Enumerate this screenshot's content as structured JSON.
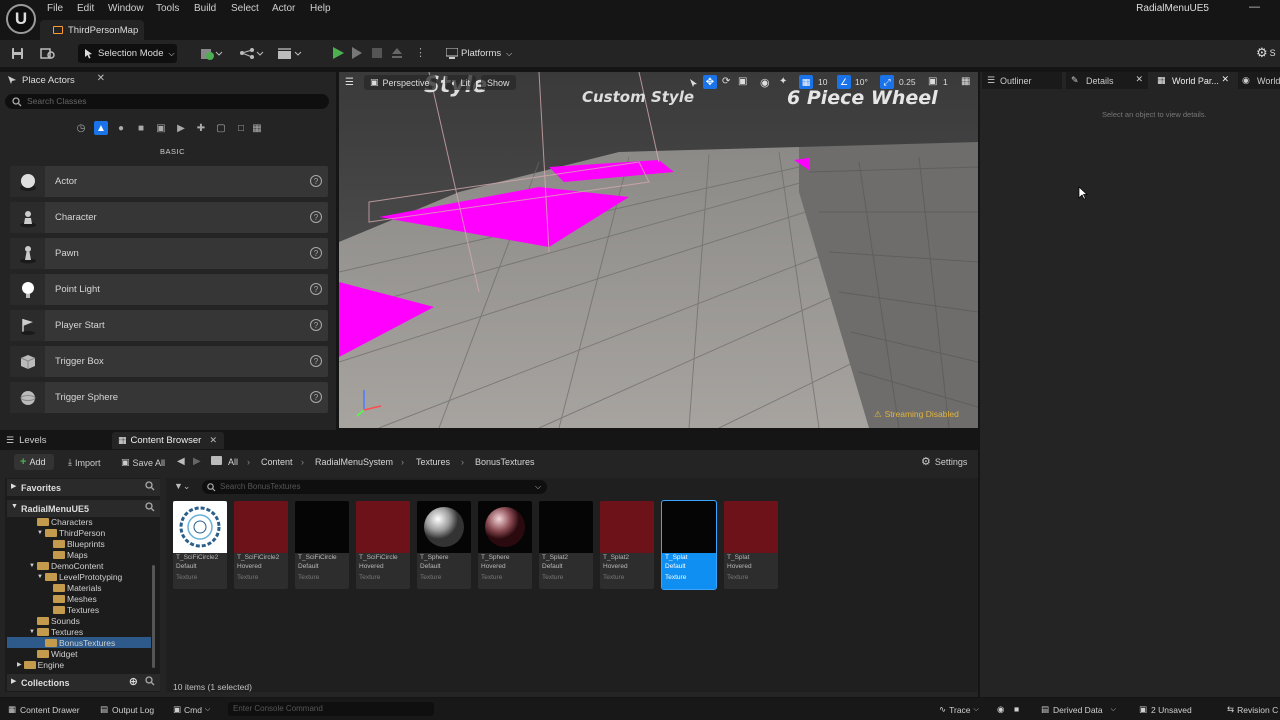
{
  "menubar": {
    "logo": "U",
    "items": [
      "File",
      "Edit",
      "Window",
      "Tools",
      "Build",
      "Select",
      "Actor",
      "Help"
    ],
    "project_name": "RadialMenuUE5",
    "minimize": "—"
  },
  "document_tab": {
    "label": "ThirdPersonMap"
  },
  "toolbar": {
    "selection_mode": "Selection Mode",
    "platforms": "Platforms",
    "settings_partial": "S"
  },
  "place_actors": {
    "tab_label": "Place Actors",
    "search_placeholder": "Search Classes",
    "category_label": "BASIC",
    "items": [
      {
        "label": "Actor",
        "icon": "sphere-icon"
      },
      {
        "label": "Character",
        "icon": "character-icon"
      },
      {
        "label": "Pawn",
        "icon": "pawn-icon"
      },
      {
        "label": "Point Light",
        "icon": "light-bulb-icon"
      },
      {
        "label": "Player Start",
        "icon": "flag-icon"
      },
      {
        "label": "Trigger Box",
        "icon": "cube-icon"
      },
      {
        "label": "Trigger Sphere",
        "icon": "sphere-icon"
      }
    ]
  },
  "viewport": {
    "perspective": "Perspective",
    "lit": "Lit",
    "show": "Show",
    "grid_snap": "10",
    "rotation_snap": "10°",
    "scale_snap": "0.25",
    "camera_speed": "1",
    "scene_text_1": "Style",
    "scene_text_2": "Custom Style",
    "scene_text_3": "6 Piece Wheel",
    "streaming_status": "Streaming Disabled",
    "accent_color": "#ff00ff"
  },
  "right_panel": {
    "tabs": [
      "Outliner",
      "Details",
      "World Par...",
      "World"
    ],
    "empty_message": "Select an object to view details."
  },
  "bottom_tabs": {
    "levels": "Levels",
    "content_browser": "Content Browser"
  },
  "content_browser": {
    "add": "Add",
    "import": "Import",
    "save_all": "Save All",
    "settings": "Settings",
    "breadcrumb": [
      "All",
      "Content",
      "RadialMenuSystem",
      "Textures",
      "BonusTextures"
    ],
    "filter_placeholder": "Search BonusTextures",
    "favorites": "Favorites",
    "project_root": "RadialMenuUE5",
    "tree": [
      {
        "label": "Characters",
        "depth": 2
      },
      {
        "label": "ThirdPerson",
        "depth": 2
      },
      {
        "label": "Blueprints",
        "depth": 3
      },
      {
        "label": "Maps",
        "depth": 3
      },
      {
        "label": "DemoContent",
        "depth": 1
      },
      {
        "label": "LevelPrototyping",
        "depth": 2
      },
      {
        "label": "Materials",
        "depth": 3
      },
      {
        "label": "Meshes",
        "depth": 3
      },
      {
        "label": "Textures",
        "depth": 3
      },
      {
        "label": "Sounds",
        "depth": 1
      },
      {
        "label": "Textures",
        "depth": 1
      },
      {
        "label": "BonusTextures",
        "depth": 2
      },
      {
        "label": "Widget",
        "depth": 1
      },
      {
        "label": "Engine",
        "depth": 0
      }
    ],
    "collections": "Collections",
    "assets": [
      {
        "name1": "T_SciFiCircle2",
        "name2": "Default",
        "type": "Texture",
        "thumb": "circle"
      },
      {
        "name1": "T_SciFiCircle2",
        "name2": "Hovered",
        "type": "Texture",
        "thumb": "red"
      },
      {
        "name1": "T_SciFiCircle",
        "name2": "Default",
        "type": "Texture",
        "thumb": "black"
      },
      {
        "name1": "T_SciFiCircle",
        "name2": "Hovered",
        "type": "Texture",
        "thumb": "red"
      },
      {
        "name1": "T_Sphere",
        "name2": "Default",
        "type": "Texture",
        "thumb": "sphere-grey"
      },
      {
        "name1": "T_Sphere",
        "name2": "Hovered",
        "type": "Texture",
        "thumb": "sphere-red"
      },
      {
        "name1": "T_Splat2",
        "name2": "Default",
        "type": "Texture",
        "thumb": "black"
      },
      {
        "name1": "T_Splat2",
        "name2": "Hovered",
        "type": "Texture",
        "thumb": "red"
      },
      {
        "name1": "T_Splat",
        "name2": "Default",
        "type": "Texture",
        "thumb": "black",
        "selected": true
      },
      {
        "name1": "T_Splat",
        "name2": "Hovered",
        "type": "Texture",
        "thumb": "red"
      }
    ],
    "item_count": "10 items (1 selected)"
  },
  "statusbar": {
    "content_drawer": "Content Drawer",
    "output_log": "Output Log",
    "cmd": "Cmd",
    "console_placeholder": "Enter Console Command",
    "trace": "Trace",
    "derived_data": "Derived Data",
    "unsaved": "2 Unsaved",
    "revision": "Revision C"
  }
}
